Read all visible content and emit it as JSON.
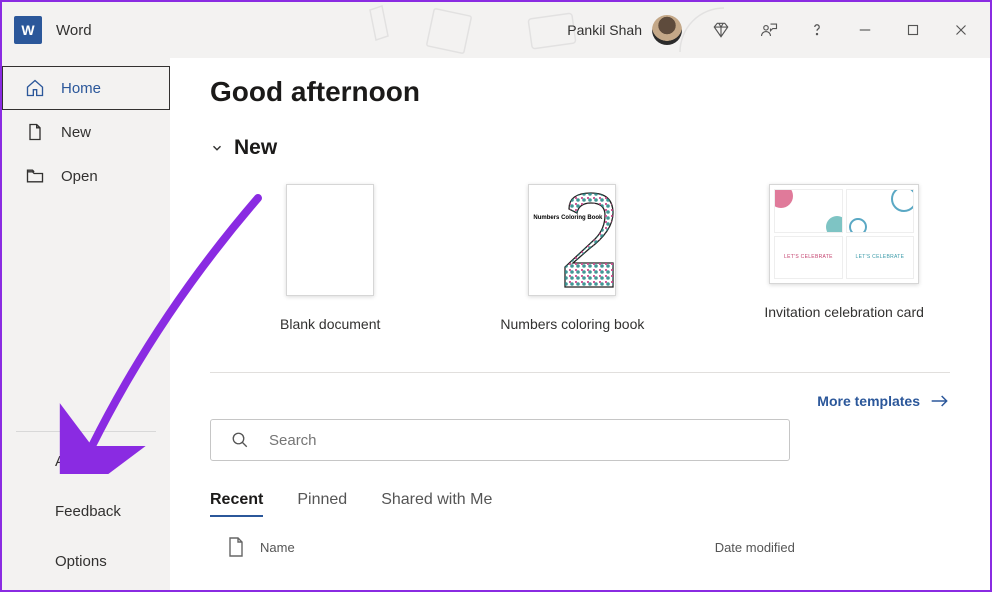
{
  "app": {
    "title": "Word",
    "logo_letter": "W"
  },
  "user": {
    "name": "Pankil Shah"
  },
  "sidebar": {
    "top": [
      {
        "label": "Home",
        "icon": "home",
        "active": true
      },
      {
        "label": "New",
        "icon": "document"
      },
      {
        "label": "Open",
        "icon": "folder"
      }
    ],
    "bottom": [
      {
        "label": "Account"
      },
      {
        "label": "Feedback"
      },
      {
        "label": "Options"
      }
    ]
  },
  "main": {
    "greeting": "Good afternoon",
    "new_section_title": "New",
    "templates": [
      {
        "label": "Blank document"
      },
      {
        "label": "Numbers coloring book",
        "thumb_text": "Numbers Coloring Book"
      },
      {
        "label": "Invitation celebration card",
        "celebrate_text": "LET'S CELEBRATE"
      }
    ],
    "more_templates_label": "More templates",
    "search_placeholder": "Search",
    "tabs": [
      {
        "label": "Recent",
        "active": true
      },
      {
        "label": "Pinned"
      },
      {
        "label": "Shared with Me"
      }
    ],
    "table": {
      "name_header": "Name",
      "date_header": "Date modified"
    }
  }
}
